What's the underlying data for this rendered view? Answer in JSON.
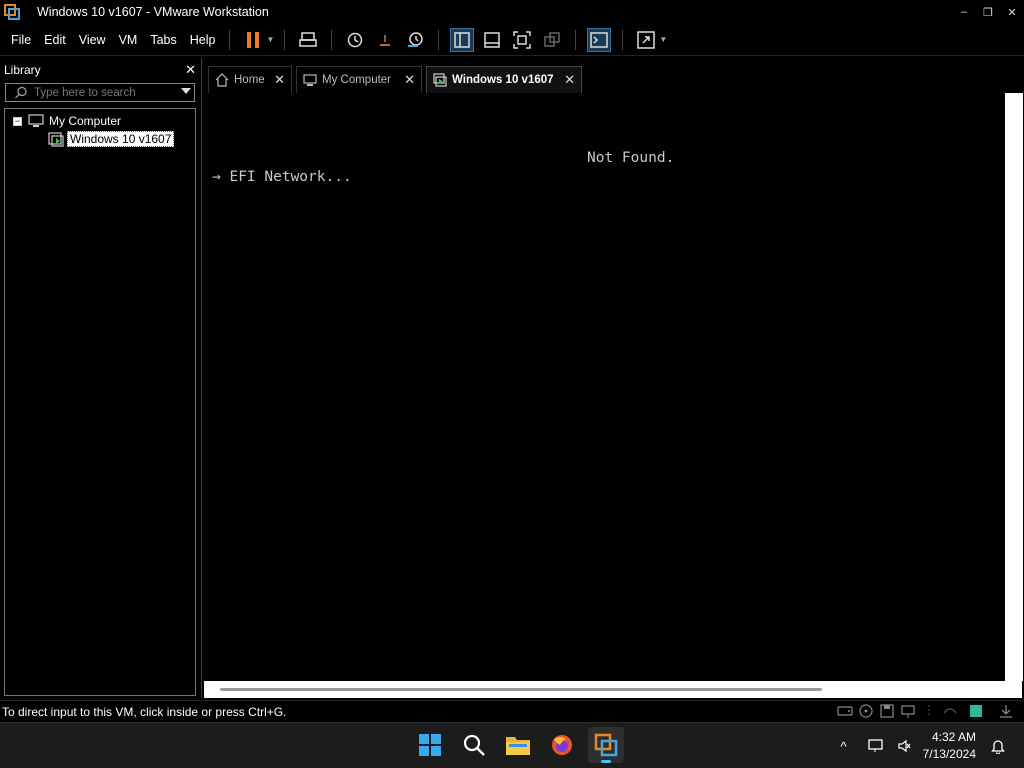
{
  "window": {
    "title": "Windows 10 v1607 - VMware Workstation",
    "minimize": "–",
    "maximize": "❐",
    "close": "✕"
  },
  "menu": {
    "items": [
      "File",
      "Edit",
      "View",
      "VM",
      "Tabs",
      "Help"
    ]
  },
  "library": {
    "title": "Library",
    "close": "✕",
    "search_placeholder": "Type here to search",
    "tree": {
      "root": {
        "label": "My Computer",
        "toggle": "−"
      },
      "child": {
        "label": "Windows 10 v1607"
      }
    }
  },
  "tabs": [
    {
      "label": "Home",
      "close": "✕"
    },
    {
      "label": "My Computer",
      "close": "✕"
    },
    {
      "label": "Windows 10 v1607",
      "close": "✕"
    }
  ],
  "console": {
    "line1": "Not Found.",
    "line2": "→ EFI Network..."
  },
  "status": {
    "text": "To direct input to this VM, click inside or press Ctrl+G."
  },
  "clock": {
    "time": "4:32 AM",
    "date": "7/13/2024"
  },
  "tray": {
    "chevron": "^"
  },
  "colors": {
    "accent": "#4cc2ff",
    "vmware_orange": "#e08b2a",
    "vmware_blue": "#4aa3df",
    "pause_orange": "#f07b2a"
  }
}
